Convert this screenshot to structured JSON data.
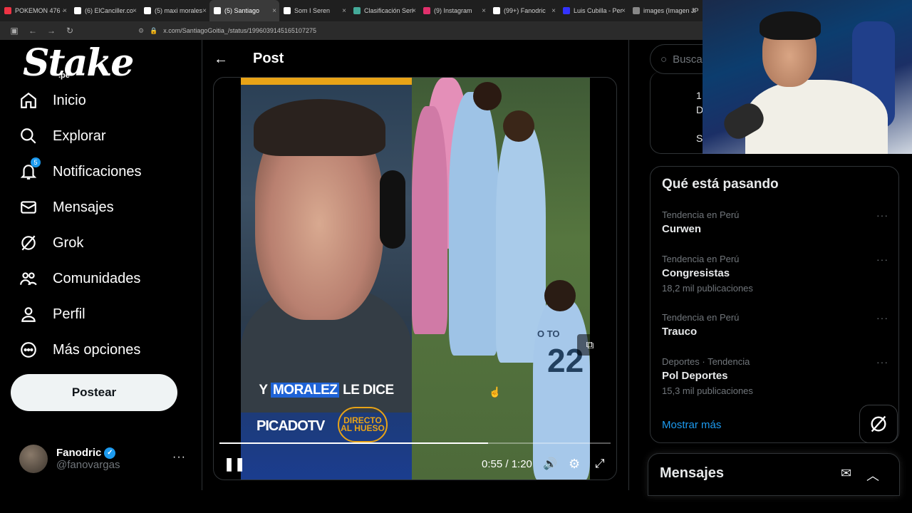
{
  "browser": {
    "tabs": [
      {
        "label": "POKEMON 476 ·",
        "color": "#e34"
      },
      {
        "label": "(6) ElCanciller.co",
        "color": "#fff"
      },
      {
        "label": "(5) maxi morales",
        "color": "#fff"
      },
      {
        "label": "(5) Santiago",
        "color": "#fff",
        "active": true
      },
      {
        "label": "Som I Seren",
        "color": "#fff"
      },
      {
        "label": "Clasificación Seri",
        "color": "#4a9"
      },
      {
        "label": "(9) Instagram",
        "color": "#e1306c"
      },
      {
        "label": "(99+) Fanodric",
        "color": "#fff"
      },
      {
        "label": "Luis Cubilla - Per",
        "color": "#33f"
      },
      {
        "label": "images (Imagen JPE",
        "color": "#888"
      }
    ],
    "url": "x.com/SantiagoGoitia_/status/1996039145165107275"
  },
  "sidebar": {
    "logo": "Stake",
    "logo_sub": ".pe",
    "nav": [
      {
        "label": "Inicio",
        "icon": "home-icon"
      },
      {
        "label": "Explorar",
        "icon": "search-icon"
      },
      {
        "label": "Notificaciones",
        "icon": "bell-icon",
        "badge": "5"
      },
      {
        "label": "Mensajes",
        "icon": "mail-icon"
      },
      {
        "label": "Grok",
        "icon": "grok-icon"
      },
      {
        "label": "Comunidades",
        "icon": "people-icon"
      },
      {
        "label": "Perfil",
        "icon": "person-icon"
      },
      {
        "label": "Más opciones",
        "icon": "more-circle-icon"
      }
    ],
    "post_button": "Postear",
    "profile": {
      "name": "Fanodric",
      "handle": "@fanovargas",
      "more": "···"
    }
  },
  "main": {
    "title": "Post",
    "video": {
      "caption_hl": "MORALEZ",
      "caption_pre": "Y ",
      "caption_post": " LE DICE",
      "brand": "PICADOTV",
      "brand2": "DIRECTO AL HUESO",
      "time": "0:55 / 1:20",
      "progress": 0.6875,
      "jersey_text": "O TO",
      "jersey_number": "22"
    }
  },
  "right": {
    "search_placeholder": "Busca",
    "trending_title": "Qué está pasando",
    "trends": [
      {
        "category": "Tendencia en Perú",
        "name": "Curwen",
        "count": ""
      },
      {
        "category": "Tendencia en Perú",
        "name": "Congresistas",
        "count": "18,2 mil publicaciones"
      },
      {
        "category": "Tendencia en Perú",
        "name": "Trauco",
        "count": ""
      },
      {
        "category": "Deportes · Tendencia",
        "name": "Pol Deportes",
        "count": "15,3 mil publicaciones"
      }
    ],
    "show_more": "Mostrar más",
    "messages_title": "Mensajes",
    "preview_lines": [
      "1",
      "D",
      "S"
    ]
  }
}
